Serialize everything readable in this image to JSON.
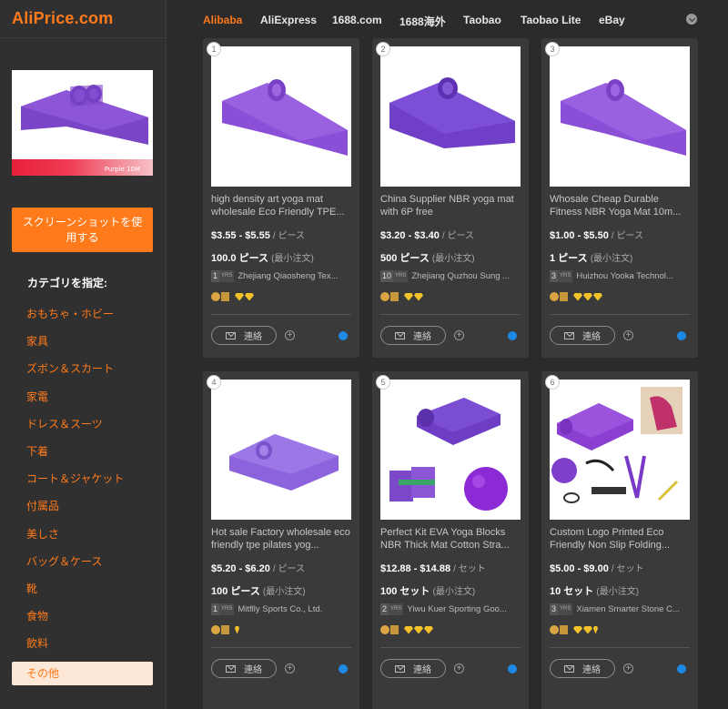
{
  "app": {
    "logo": "AliPrice.com"
  },
  "sidebar": {
    "thumb_caption": "Purple 10M",
    "screenshot_button": "スクリーンショットを使用する",
    "category_heading": "カテゴリを指定:",
    "categories": [
      "おもちゃ・ホビー",
      "家具",
      "ズボン＆スカート",
      "家電",
      "ドレス＆スーツ",
      "下着",
      "コート＆ジャケット",
      "付属品",
      "美しさ",
      "バッグ＆ケース",
      "靴",
      "食物",
      "飲料",
      "その他"
    ],
    "active_category": "その他"
  },
  "tabs": [
    "Alibaba",
    "AliExpress",
    "1688.com",
    "1688海外",
    "Taobao",
    "Taobao Lite",
    "eBay"
  ],
  "active_tab": "Alibaba",
  "colors": {
    "accent": "#ff7a1a",
    "background": "#2b2b2b",
    "card": "#3a3a3a",
    "chat": "#1e88e5"
  },
  "contact_label": "連絡",
  "products": [
    {
      "index": "1",
      "title": "high density art yoga mat wholesale Eco Friendly TPE...",
      "price": "$3.55 - $5.55",
      "unit": "/ ピース",
      "moq": "100.0 ピース",
      "moq_note": "(最小注文)",
      "years": "1",
      "yrs_label": "YRS",
      "supplier": "Zhejiang Qiaosheng Tex...",
      "badge_type": "circle-box",
      "diamonds": "2"
    },
    {
      "index": "2",
      "title": "China Supplier NBR yoga mat with 6P free",
      "price": "$3.20 - $3.40",
      "unit": "/ ピース",
      "moq": "500 ピース",
      "moq_note": "(最小注文)",
      "years": "10",
      "yrs_label": "YRS",
      "supplier": "Zhejiang Quzhou Sung ...",
      "badge_type": "circle-box",
      "diamonds": "2"
    },
    {
      "index": "3",
      "title": "Whosale Cheap Durable Fitness NBR Yoga Mat 10m...",
      "price": "$1.00 - $5.50",
      "unit": "/ ピース",
      "moq": "1 ピース",
      "moq_note": "(最小注文)",
      "years": "3",
      "yrs_label": "YRS",
      "supplier": "Huizhou Yooka Technol...",
      "badge_type": "circle-box",
      "diamonds": "3"
    },
    {
      "index": "4",
      "title": "Hot sale Factory wholesale eco friendly tpe pilates yog...",
      "price": "$5.20 - $6.20",
      "unit": "/ ピース",
      "moq": "100 ピース",
      "moq_note": "(最小注文)",
      "years": "1",
      "yrs_label": "YRS",
      "supplier": "Mitflly Sports Co., Ltd.",
      "badge_type": "circle-box",
      "diamonds": "0.5"
    },
    {
      "index": "5",
      "title": "Perfect Kit EVA Yoga Blocks NBR Thick Mat Cotton Stra...",
      "price": "$12.88 - $14.88",
      "unit": "/ セット",
      "moq": "100 セット",
      "moq_note": "(最小注文)",
      "years": "2",
      "yrs_label": "YRS",
      "supplier": "Yiwu Kuer Sporting Goo...",
      "badge_type": "circle-box",
      "diamonds": "3"
    },
    {
      "index": "6",
      "title": "Custom Logo Printed Eco Friendly Non Slip Folding...",
      "price": "$5.00 - $9.00",
      "unit": "/ セット",
      "moq": "10 セット",
      "moq_note": "(最小注文)",
      "years": "3",
      "yrs_label": "YRS",
      "supplier": "Xiamen Smarter Stone C...",
      "badge_type": "circle-box",
      "diamonds": "2.5"
    }
  ]
}
